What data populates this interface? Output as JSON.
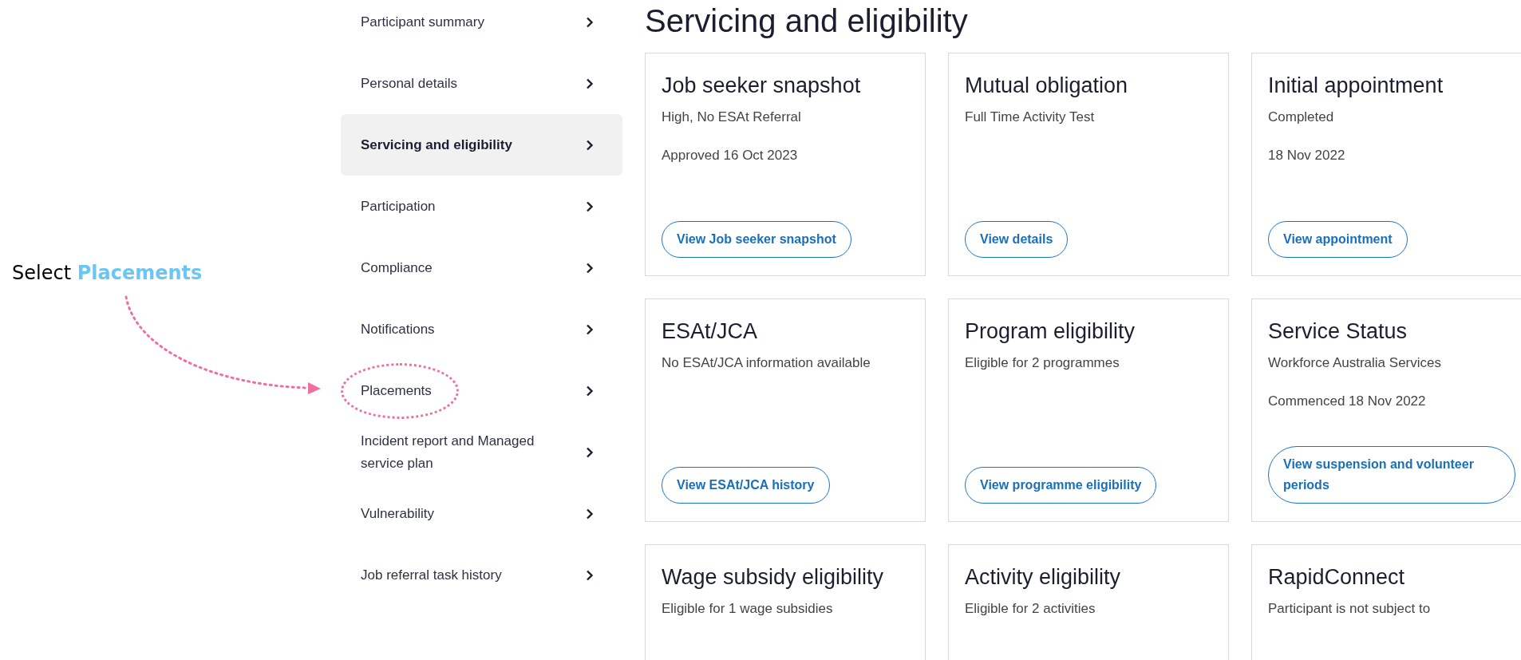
{
  "annotation": {
    "text": "Select",
    "highlight": "Placements"
  },
  "sidebar": {
    "items": [
      {
        "label": "Participant summary",
        "selected": false
      },
      {
        "label": "Personal details",
        "selected": false
      },
      {
        "label": "Servicing and eligibility",
        "selected": true
      },
      {
        "label": "Participation",
        "selected": false
      },
      {
        "label": "Compliance",
        "selected": false
      },
      {
        "label": "Notifications",
        "selected": false
      },
      {
        "label": "Placements",
        "selected": false,
        "circled": true
      },
      {
        "label": "Incident report and Managed service plan",
        "selected": false
      },
      {
        "label": "Vulnerability",
        "selected": false
      },
      {
        "label": "Job referral task history",
        "selected": false
      }
    ]
  },
  "page_title": "Servicing and eligibility",
  "cards": [
    {
      "title": "Job seeker snapshot",
      "lines": [
        "High, No ESAt Referral",
        "Approved 16 Oct 2023"
      ],
      "button": "View Job seeker snapshot"
    },
    {
      "title": "Mutual obligation",
      "lines": [
        "Full Time Activity Test"
      ],
      "button": "View details"
    },
    {
      "title": "Initial appointment",
      "lines": [
        "Completed",
        "18 Nov 2022"
      ],
      "button": "View appointment"
    },
    {
      "title": "ESAt/JCA",
      "lines": [
        "No ESAt/JCA information available"
      ],
      "button": "View ESAt/JCA history"
    },
    {
      "title": "Program eligibility",
      "lines": [
        "Eligible for 2 programmes"
      ],
      "button": "View programme eligibility"
    },
    {
      "title": "Service Status",
      "lines": [
        "Workforce Australia Services",
        "Commenced 18 Nov 2022"
      ],
      "button": "View suspension and volunteer periods"
    },
    {
      "title": "Wage subsidy eligibility",
      "lines": [
        "Eligible for 1 wage subsidies"
      ]
    },
    {
      "title": "Activity eligibility",
      "lines": [
        "Eligible for 2 activities"
      ]
    },
    {
      "title": "RapidConnect",
      "lines": [
        "Participant is not subject to"
      ]
    }
  ]
}
